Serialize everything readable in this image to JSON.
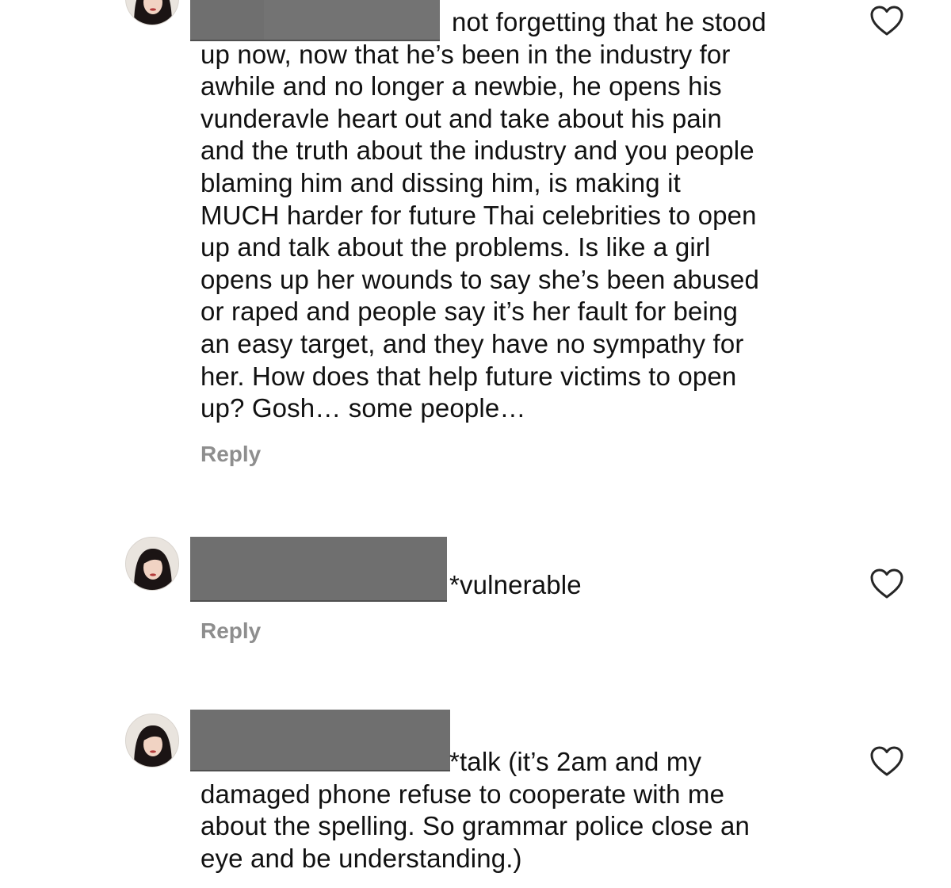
{
  "comments": [
    {
      "text": "not forgetting that he stood\nup now, now that he’s been in the industry for\nawhile and no longer a newbie, he opens his\nvunderavle heart out and take about his pain\nand the truth about the industry and you people\nblaming him and dissing him, is making it\nMUCH harder for future Thai celebrities to open\nup and talk about the problems. Is like a girl\nopens up her wounds to say she’s been abused\nor raped and people say it’s her fault for being\nan easy target, and they have no sympathy for\nher. How does that help future victims to open\nup? Gosh… some people…",
      "reply_label": "Reply",
      "like_icon": "heart-outline-icon"
    },
    {
      "text": "*vulnerable",
      "reply_label": "Reply",
      "like_icon": "heart-outline-icon"
    },
    {
      "text": "*talk (it’s 2am and my\ndamaged phone refuse to cooperate with me\nabout the spelling. So grammar police close an\neye and be understanding.)",
      "like_icon": "heart-outline-icon"
    }
  ],
  "colors": {
    "text": "#111111",
    "reply": "#8e8e8e",
    "redaction": "#6f6f6f",
    "heart_stroke": "#262626"
  }
}
